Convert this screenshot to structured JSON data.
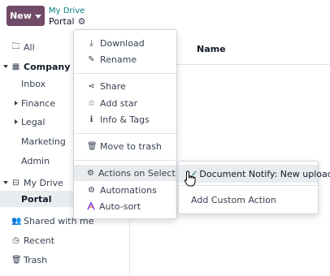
{
  "topbar": {
    "new_label": "New",
    "breadcrumb_parent": "My Drive",
    "breadcrumb_current": "Portal",
    "settings_icon": "gear-icon"
  },
  "sidebar": {
    "items": [
      {
        "label": "All",
        "icon": "folder-icon"
      },
      {
        "label": "Company",
        "icon": "building-icon",
        "expanded": true
      },
      {
        "label": "Inbox"
      },
      {
        "label": "Finance",
        "collapsed": true
      },
      {
        "label": "Legal",
        "collapsed": true
      },
      {
        "label": "Marketing"
      },
      {
        "label": "Admin"
      },
      {
        "label": "My Drive",
        "icon": "hdd-icon",
        "expanded": true
      },
      {
        "label": "Portal",
        "active": true
      },
      {
        "label": "Shared with me",
        "icon": "users-icon"
      },
      {
        "label": "Recent",
        "icon": "clock-icon"
      },
      {
        "label": "Trash",
        "icon": "trash-icon"
      }
    ]
  },
  "main": {
    "column_name": "Name"
  },
  "menu": {
    "items": [
      {
        "label": "Download",
        "icon": "download-icon"
      },
      {
        "label": "Rename",
        "icon": "edit-icon"
      },
      {
        "label": "Share",
        "icon": "share-icon"
      },
      {
        "label": "Add star",
        "icon": "star-icon"
      },
      {
        "label": "Info & Tags",
        "icon": "info-icon"
      },
      {
        "label": "Move to trash",
        "icon": "trash-icon"
      },
      {
        "label": "Actions on Select",
        "icon": "gear-icon",
        "has_submenu": true
      },
      {
        "label": "Automations",
        "icon": "gear-icon"
      },
      {
        "label": "Auto-sort",
        "icon": "ai-sort-icon"
      }
    ]
  },
  "submenu": {
    "items": [
      {
        "label": "Document Notify: New upload",
        "checked": true
      },
      {
        "label": "Add Custom Action"
      }
    ]
  },
  "colors": {
    "brand": "#714b67",
    "link": "#017e84",
    "hover": "#e9ecef"
  }
}
